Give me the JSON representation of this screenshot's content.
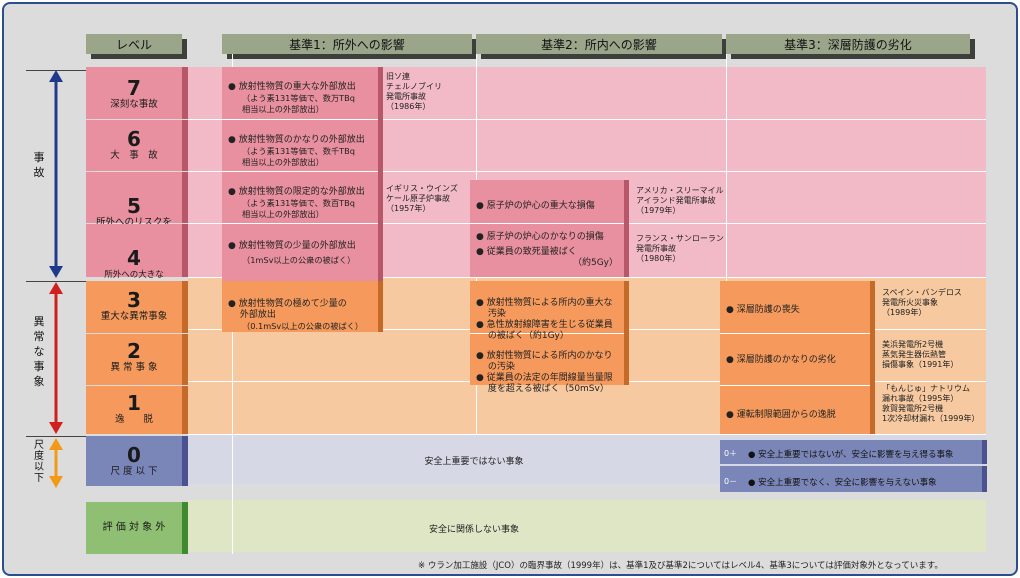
{
  "headers": {
    "level": "レベル",
    "criterion1": "基準1：所外への影響",
    "criterion2": "基準2：所内への影響",
    "criterion3": "基準3：深層防護の劣化"
  },
  "side_labels": {
    "accident": "事\n故",
    "anomaly": "異\n常\nな\n事\n象",
    "below_scale": "尺\n度\n以\n下"
  },
  "levels": [
    {
      "num": "7",
      "caption": "深刻な事故"
    },
    {
      "num": "6",
      "caption": "大　事　故"
    },
    {
      "num": "5",
      "caption": "所外へのリスクを\n伴う事故"
    },
    {
      "num": "4",
      "caption": "所外への大きな\nリスクを伴わない事故"
    },
    {
      "num": "3",
      "caption": "重大な異常事象"
    },
    {
      "num": "2",
      "caption": "異 常 事 象"
    },
    {
      "num": "1",
      "caption": "逸　　脱"
    },
    {
      "num": "0",
      "caption": "尺 度 以 下"
    }
  ],
  "out_of_scope": "評 価 対 象 外",
  "c1": {
    "l7": {
      "item": "● 放射性物質の重大な外部放出",
      "sub": "（よう素131等価で、数万TBq\n相当以上の外部放出）"
    },
    "l6": {
      "item": "● 放射性物質のかなりの外部放出",
      "sub": "（よう素131等価で、数千TBq\n相当以上の外部放出）"
    },
    "l5": {
      "item": "● 放射性物質の限定的な外部放出",
      "sub": "（よう素131等価で、数百TBq\n相当以上の外部放出）"
    },
    "l4": {
      "item": "● 放射性物質の少量の外部放出",
      "sub": "（1mSv以上の公衆の被ばく）"
    },
    "l3": {
      "item": "● 放射性物質の極めて少量の\n　 外部放出",
      "sub": "（0.1mSv以上の公衆の被ばく）"
    }
  },
  "c1_notes": {
    "chernobyl": "旧ソ連\nチェルノブイリ\n発電所事故\n（1986年）",
    "windscale": "イギリス・ウインズ\nケール原子炉事故\n（1957年）"
  },
  "c2": {
    "l5": "● 原子炉の炉心の重大な損傷",
    "l4a": "● 原子炉の炉心のかなりの損傷",
    "l4b": "● 従業員の致死量被ばく",
    "l4b_val": "（約5Gy）",
    "l3a": "● 放射性物質による所内の重大な\n　 汚染",
    "l3b": "● 急性放射線障害を生じる従業員\n　 の被ばく（約1Gy）",
    "l2a": "● 放射性物質による所内のかなり\n　 の汚染",
    "l2b": "● 従業員の法定の年間線量当量限\n　 度を超える被ばく（50mSv）"
  },
  "c2_notes": {
    "tmi": "アメリカ・スリーマイル\nアイランド発電所事故\n（1979年）",
    "saint_laurent": "フランス・サンローラン\n発電所事故\n（1980年）"
  },
  "c3": {
    "l3": "● 深層防護の喪失",
    "l2": "● 深層防護のかなりの劣化",
    "l1": "● 運転制限範囲からの逸脱",
    "l0plus_tag": "0＋",
    "l0plus": "● 安全上重要ではないが、安全に影響を与え得る事象",
    "l0minus_tag": "0－",
    "l0minus": "● 安全上重要でなく、安全に影響を与えない事象"
  },
  "c3_notes": {
    "vandellos": "スペイン・バンデロス\n発電所火災事象\n（1989年）",
    "mihama": "美浜発電所2号機\n蒸気発生器伝熱管\n損傷事象（1991年）",
    "monju": "「もんじゅ」ナトリウム\n漏れ事故（1995年）\n敦賀発電所2号機\n1次冷却材漏れ（1999年）"
  },
  "level0_text": "安全上重要ではない事象",
  "out_of_scope_text": "安全に関係しない事象",
  "footnote": "※ ウラン加工施設（JCO）の臨界事故（1999年）は、基準1及び基準2についてはレベル4、基準3については評価対象外となっています。",
  "colors": {
    "pink_band": "#f2b9c6",
    "orange_band": "#f6c9a0",
    "blue_band": "#d6d8e6",
    "green_band": "#dfe6c6",
    "accident_arrow": "#1f3a8a",
    "anomaly_arrow": "#d01f1f",
    "below_scale_arrow": "#f29a17"
  }
}
